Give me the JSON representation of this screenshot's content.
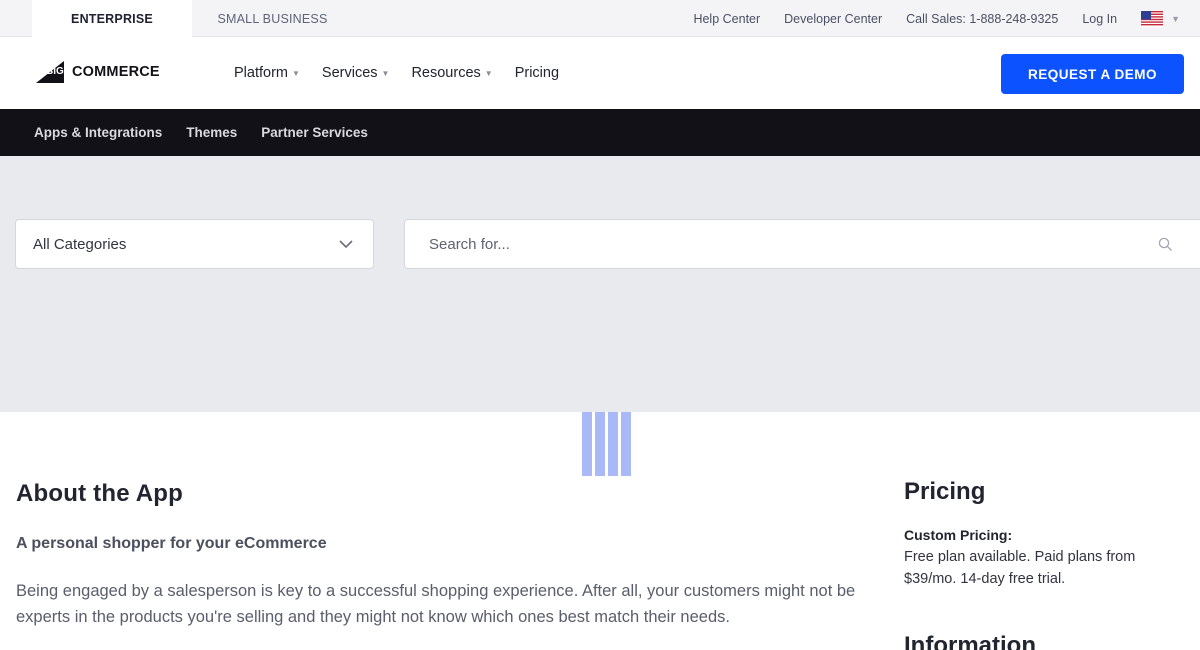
{
  "topbar": {
    "tabs": [
      {
        "label": "ENTERPRISE",
        "active": true
      },
      {
        "label": "SMALL BUSINESS",
        "active": false
      }
    ],
    "links": {
      "help_center": "Help Center",
      "developer_center": "Developer Center",
      "call_sales": "Call Sales: 1-888-248-9325",
      "log_in": "Log In"
    },
    "locale_flag": "us-flag-icon"
  },
  "header": {
    "logo_big": "BIG",
    "logo_text": "COMMERCE",
    "nav": [
      {
        "label": "Platform",
        "dropdown": true
      },
      {
        "label": "Services",
        "dropdown": true
      },
      {
        "label": "Resources",
        "dropdown": true
      },
      {
        "label": "Pricing",
        "dropdown": false
      }
    ],
    "cta_label": "REQUEST A DEMO",
    "cta_color": "#0d52ff"
  },
  "subnav": {
    "items": [
      "Apps & Integrations",
      "Themes",
      "Partner Services"
    ]
  },
  "search": {
    "category_value": "All Categories",
    "placeholder": "Search for..."
  },
  "about": {
    "title": "About the App",
    "subtitle": "A personal shopper for your eCommerce",
    "body": "Being engaged by a salesperson is key to a successful shopping experience. After all, your customers might not be experts in the products you're selling and they might not know which ones best match their needs."
  },
  "pricing": {
    "title": "Pricing",
    "label": "Custom Pricing:",
    "description": "Free plan available. Paid plans from $39/mo. 14-day free trial."
  },
  "information": {
    "title": "Information"
  }
}
